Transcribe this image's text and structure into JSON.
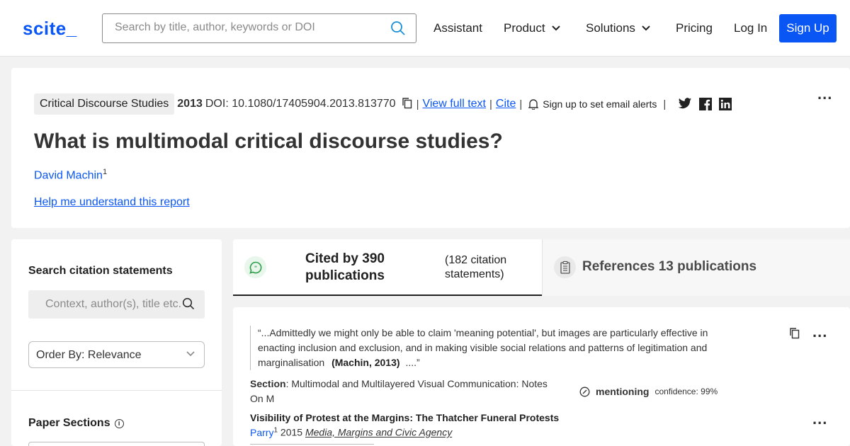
{
  "header": {
    "logo": "scite_",
    "search_placeholder": "Search by title, author, keywords or DOI",
    "nav": {
      "assistant": "Assistant",
      "product": "Product",
      "solutions": "Solutions",
      "pricing": "Pricing",
      "login": "Log In",
      "signup": "Sign Up"
    }
  },
  "paper": {
    "journal": "Critical Discourse Studies",
    "year": "2013",
    "doi": "DOI: 10.1080/17405904.2013.813770",
    "view_full_text": "View full text",
    "cite": "Cite",
    "email_alerts": "Sign up to set email alerts",
    "separator": "|",
    "title": "What is multimodal critical discourse studies?",
    "author": "David Machin",
    "author_sup": "1",
    "help_link": "Help me understand this report",
    "more": "..."
  },
  "sidebar": {
    "search_heading": "Search citation statements",
    "search_placeholder": "Context, author(s), title etc.",
    "order_by": "Order By: Relevance",
    "paper_sections": "Paper Sections",
    "info": "i"
  },
  "tabs": {
    "cited_title": "Cited by 390 publications",
    "cited_sub": "(182 citation statements)",
    "refs_title": "References 13 publications"
  },
  "citation": {
    "quote_text": "“...Admittedly we might only be able to claim 'meaning potential', but images are particularly effective in enacting inclusion and exclusion, and in making visible social relations and patterns of legitimation and marginalisation",
    "quote_ref": "(Machin, 2013)",
    "quote_end": "....”",
    "section_label": "Section",
    "section_text": ": Multimodal and Multilayered Visual Communication: Notes On M",
    "mention_label": "mentioning",
    "confidence": "confidence: 99%",
    "pub_title": "Visibility of Protest at the Margins: The Thatcher Funeral Protests",
    "pub_author": "Parry",
    "pub_author_sup": "1",
    "pub_year": "2015",
    "pub_venue": "Media, Margins and Civic Agency",
    "more": "..."
  },
  "colors": {
    "brand": "#0a56f5",
    "background": "#f2f2f2",
    "mention_bubble": "#e9f6ec",
    "mention_green": "#2e9e4a"
  }
}
